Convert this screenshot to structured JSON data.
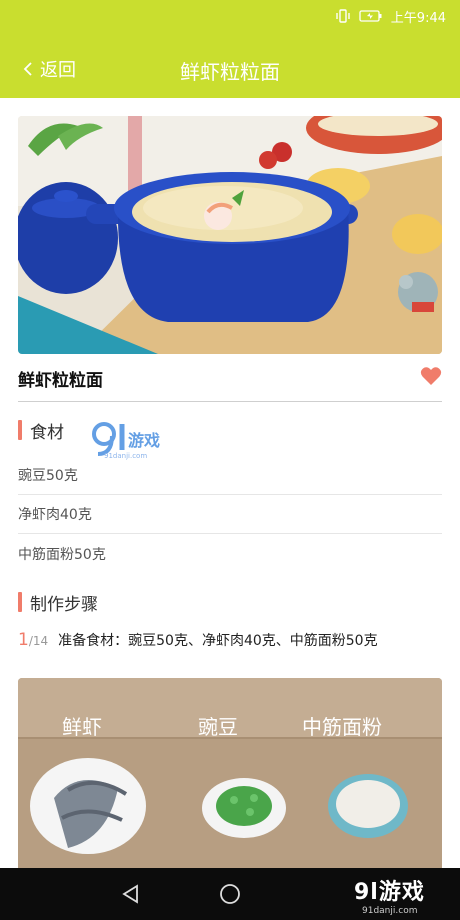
{
  "status_bar": {
    "time": "上午9:44"
  },
  "header": {
    "back_label": "返回",
    "title": "鲜虾粒粒面"
  },
  "dish": {
    "name": "鲜虾粒粒面"
  },
  "ingredients": {
    "heading": "食材",
    "items": [
      "豌豆50克",
      "净虾肉40克",
      "中筋面粉50克"
    ]
  },
  "steps": {
    "heading": "制作步骤",
    "current": "1",
    "total": "/14",
    "text": "准备食材：豌豆50克、净虾肉40克、中筋面粉50克",
    "image_labels": [
      "鲜虾",
      "豌豆",
      "中筋面粉"
    ]
  },
  "watermark": {
    "logo": "9l游戏",
    "site": "91danji.com"
  },
  "nav_brand": {
    "logo": "9l游戏",
    "site": "91danji.com"
  },
  "colors": {
    "header": "#c9de2f",
    "accent": "#f07c6a"
  }
}
